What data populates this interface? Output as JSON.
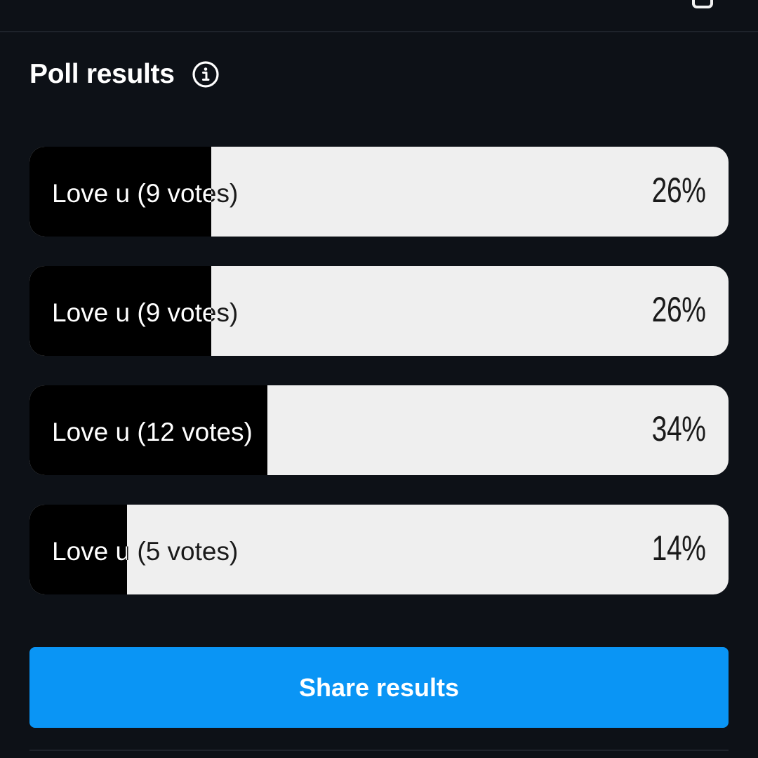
{
  "header": {
    "title": "Poll results",
    "info_icon": "info-circle-icon",
    "corner_icon": "square-icon"
  },
  "options": [
    {
      "label": "Love u (9 votes)",
      "percent_text": "26%",
      "fill_fraction": 0.26
    },
    {
      "label": "Love u (9 votes)",
      "percent_text": "26%",
      "fill_fraction": 0.26
    },
    {
      "label": "Love u (12 votes)",
      "percent_text": "34%",
      "fill_fraction": 0.34
    },
    {
      "label": "Love u (5 votes)",
      "percent_text": "14%",
      "fill_fraction": 0.14
    }
  ],
  "share_button": {
    "label": "Share results"
  },
  "colors": {
    "background": "#0d1117",
    "bar_track": "#efefef",
    "bar_fill": "#000000",
    "accent": "#0a95f5"
  }
}
